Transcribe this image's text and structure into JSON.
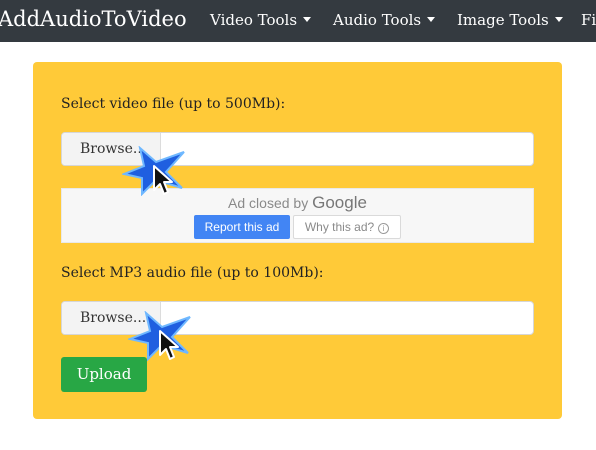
{
  "navbar": {
    "brand": "AddAudioToVideo",
    "items": [
      {
        "label": "Video Tools"
      },
      {
        "label": "Audio Tools"
      },
      {
        "label": "Image Tools"
      },
      {
        "label": "File"
      }
    ]
  },
  "form": {
    "video_label": "Select video file (up to 500Mb):",
    "video_browse": "Browse...",
    "audio_label": "Select MP3 audio file (up to 100Mb):",
    "audio_browse": "Browse...",
    "upload_label": "Upload"
  },
  "ad": {
    "closed_prefix": "Ad closed by",
    "closed_brand": "Google",
    "report_label": "Report this ad",
    "why_label": "Why this ad?",
    "info_glyph": "i"
  },
  "colors": {
    "navbar_bg": "#343a40",
    "panel_bg": "#ffca38",
    "upload_green": "#28a745",
    "report_blue": "#4285f4",
    "cursor_highlight": "#1f5fe0"
  }
}
